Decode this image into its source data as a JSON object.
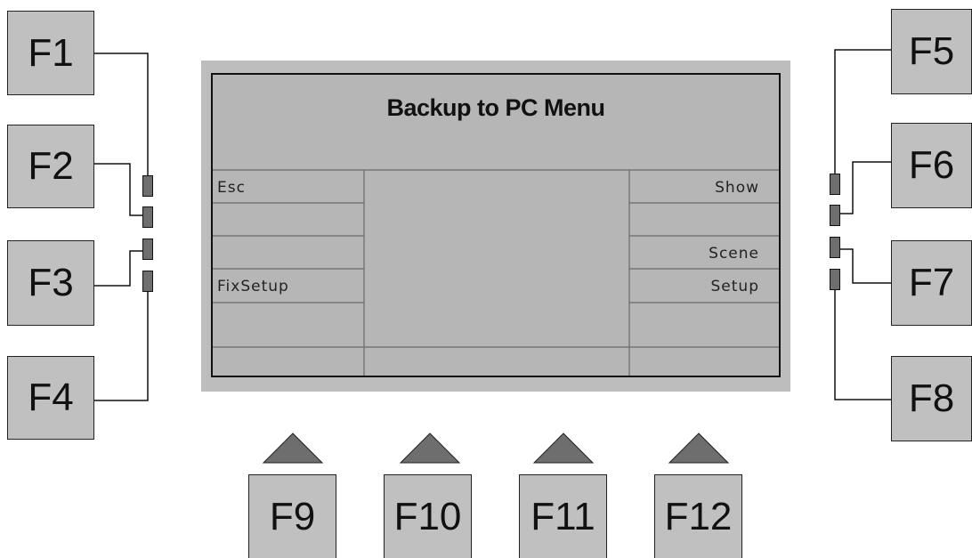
{
  "screen": {
    "title": "Backup to PC Menu",
    "left_labels": [
      "Esc",
      "",
      "",
      "FixSetup",
      ""
    ],
    "right_labels": [
      "Show",
      "",
      "Scene",
      "Setup",
      ""
    ]
  },
  "keys": {
    "f1": "F1",
    "f2": "F2",
    "f3": "F3",
    "f4": "F4",
    "f5": "F5",
    "f6": "F6",
    "f7": "F7",
    "f8": "F8",
    "f9": "F9",
    "f10": "F10",
    "f11": "F11",
    "f12": "F12"
  },
  "colors": {
    "key_fill": "#c0c0c0",
    "screen_fill": "#b6b6b6",
    "led_fill": "#6e6e6e",
    "arrow_fill": "#6e6e6e"
  }
}
